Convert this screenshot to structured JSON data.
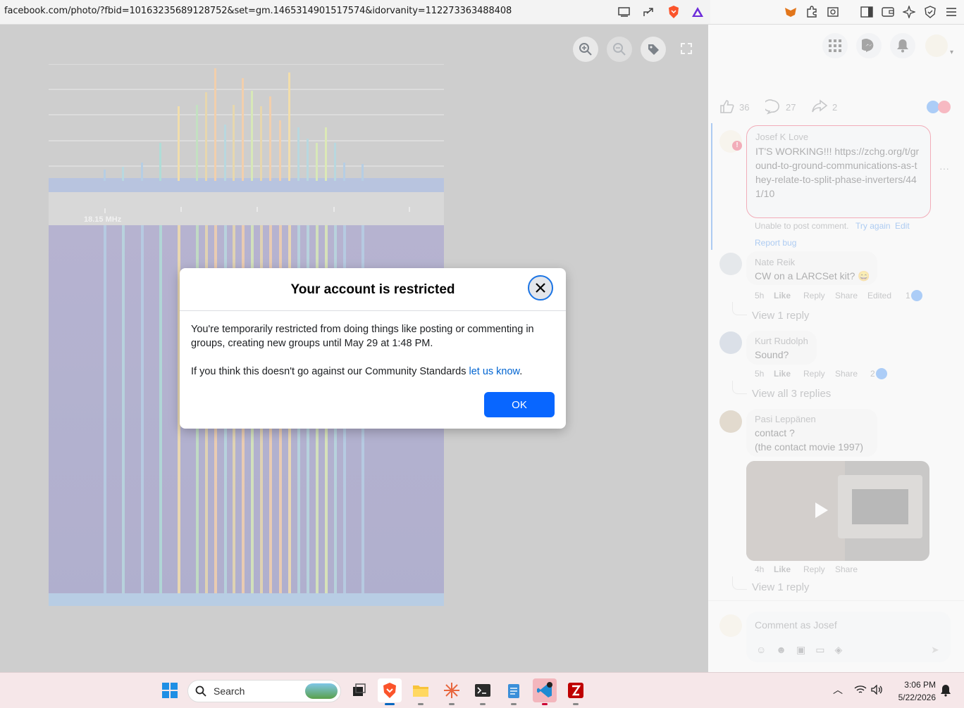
{
  "browser": {
    "url": "facebook.com/photo/?fbid=10163235689128752&set=gm.1465314901517574&idorvanity=112273363488408",
    "icons": [
      "cast-icon",
      "share-icon",
      "brave-shield-icon",
      "brave-rewards-icon",
      "metamask-icon",
      "extensions-icon",
      "screenshot-icon",
      "sidebar-icon",
      "wallet-icon",
      "leo-icon",
      "vpn-icon",
      "menu-icon"
    ]
  },
  "photo": {
    "freq_label": "18.15 MHz"
  },
  "viewer_controls": [
    "zoom-in-icon",
    "zoom-out-icon",
    "tag-icon",
    "fullscreen-icon"
  ],
  "post_stats": {
    "likes": "36",
    "comments": "27",
    "shares": "2"
  },
  "comments": [
    {
      "name": "Josef K Love",
      "text": "IT'S WORKING!!! https://zchg.org/t/ground-to-ground-communications-as-they-relate-to-split-phase-inverters/441/10",
      "error": "Unable to post comment.",
      "try_again": "Try again",
      "edit": "Edit",
      "report": "Report bug"
    },
    {
      "name": "Nate Reik",
      "text": "CW on a LARCSet kit? 😄",
      "time": "5h",
      "like": "Like",
      "reply": "Reply",
      "share": "Share",
      "edited": "Edited",
      "reactions": "1",
      "view_replies": "View 1 reply"
    },
    {
      "name": "Kurt Rudolph",
      "text": "Sound?",
      "time": "5h",
      "like": "Like",
      "reply": "Reply",
      "share": "Share",
      "reactions": "2",
      "view_replies": "View all 3 replies"
    },
    {
      "name": "Pasi Leppänen",
      "text_line1": "contact ?",
      "text_line2": "(the contact movie 1997)",
      "time": "4h",
      "like": "Like",
      "reply": "Reply",
      "share": "Share",
      "view_replies": "View 1 reply"
    }
  ],
  "composer": {
    "placeholder": "Comment as Josef"
  },
  "dialog": {
    "title": "Your account is restricted",
    "body1": "You're temporarily restricted from doing things like posting or commenting in groups, creating new groups until May 29 at 1:48 PM.",
    "body2_prefix": "If you think this doesn't go against our Community Standards ",
    "body2_link": "let us know",
    "body2_suffix": ".",
    "ok_label": "OK"
  },
  "taskbar": {
    "search_label": "Search",
    "time": "3:06 PM",
    "date": "5/22/2026"
  },
  "colors": {
    "facebook_blue": "#0866ff",
    "link_blue": "#0064d1",
    "viewer_bg": "#c4c4c4"
  }
}
